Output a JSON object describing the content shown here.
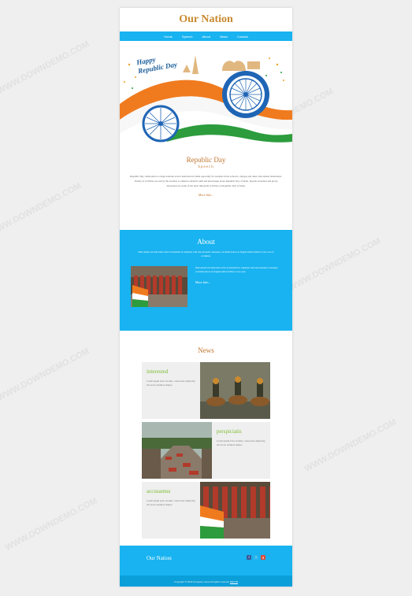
{
  "site": {
    "title": "Our Nation"
  },
  "nav": {
    "items": [
      "Home",
      "Speech",
      "About",
      "News",
      "Contact"
    ]
  },
  "hero": {
    "greeting_line1": "Happy",
    "greeting_line2": "Republic Day"
  },
  "speech": {
    "title": "Republic Day",
    "subtitle": "Speech",
    "body": "Republic Day celebration is a huge national event celebration in India especially for students in the schools, colleges and other educational institutions. Variety of activities are run by the teachers to enhance student's skill and knowledge about Republic Day of India. Speech recitation and group discussion are some of the most important activities on Republic Day of India.",
    "more": "More Info..."
  },
  "about": {
    "title": "About",
    "lead": "Duis Autem vel eum iriure dolor in hendrerit in vulputate velit esse molestie consequat, vel illum dolore eu feugiat nulla facilisis at vero eros et accumsan.",
    "text": "Duis Autem vel eum iriure dolor in hendrerit in vulputate velit esse molestie consequat, vel illum dolore eu feugiat nulla facilisis at vero eros.",
    "more": "More Info..."
  },
  "news": {
    "title": "News",
    "items": [
      {
        "heading": "interested",
        "text": "Lorem ipsum dolor sit amet, consectetur adipiscing elit sed do eiusmod tempor."
      },
      {
        "heading": "perspiciatis",
        "text": "Lorem ipsum dolor sit amet, consectetur adipiscing elit sed do eiusmod tempor."
      },
      {
        "heading": "accusamus",
        "text": "Lorem ipsum dolor sit amet, consectetur adipiscing elit sed do eiusmod tempor."
      }
    ]
  },
  "footer": {
    "brand": "Our Nation",
    "copyright": "Copyright © 2016 Company name All rights reserved",
    "copyright_link": "W3 ITS",
    "social": [
      {
        "icon": "facebook-icon",
        "glyph": "f",
        "color": "#3b5998"
      },
      {
        "icon": "twitter-icon",
        "glyph": "t",
        "color": "#2fb5ea"
      },
      {
        "icon": "googleplus-icon",
        "glyph": "g",
        "color": "#dd4b39"
      }
    ]
  },
  "watermark": "WWW.DOWNDEMO.COM",
  "colors": {
    "accent": "#18b3f0",
    "title": "#c9892f",
    "news_heading": "#7bbb2f"
  }
}
